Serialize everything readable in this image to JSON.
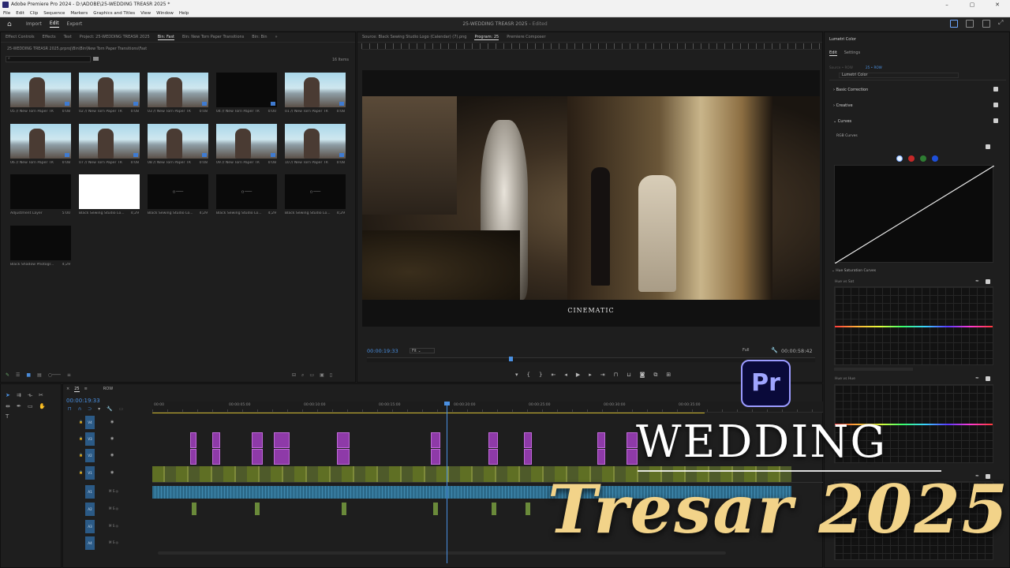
{
  "window": {
    "title": "Adobe Premiere Pro 2024 - D:\\ADOBE\\25-WEDDING TREASR 2025 *",
    "controls": [
      "–",
      "▢",
      "✕"
    ]
  },
  "menu": [
    "File",
    "Edit",
    "Clip",
    "Sequence",
    "Markers",
    "Graphics and Titles",
    "View",
    "Window",
    "Help"
  ],
  "appbar": {
    "tabs": [
      "Import",
      "Edit",
      "Export"
    ],
    "active_tab": "Edit",
    "project_name": "25-WEDDING TREASR 2025",
    "status": "Edited"
  },
  "project_panel": {
    "tabs": [
      "Effect Controls",
      "Effects",
      "Text",
      "Project: 25-WEDDING TREASR 2025",
      "Bin: Fast",
      "Bin: New Torn Paper Transitions",
      "Bin: Bin",
      "»"
    ],
    "active_tab": "Bin: Fast",
    "path": "25-WEDDING TREASR 2025.prproj\\Bin\\Bin\\New Torn Paper Transitions\\Fast",
    "item_count": "16 Items",
    "items": [
      {
        "name": "05 // New Torn Paper TR",
        "dur": "0:08",
        "kind": "photo"
      },
      {
        "name": "02 // New Torn Paper TR",
        "dur": "0:08",
        "kind": "photo"
      },
      {
        "name": "03 // New Torn Paper TR",
        "dur": "0:08",
        "kind": "photo"
      },
      {
        "name": "04 // New Torn Paper TR",
        "dur": "0:00",
        "kind": "black"
      },
      {
        "name": "01 // New Torn Paper TR",
        "dur": "0:08",
        "kind": "photo"
      },
      {
        "name": "06 // New Torn Paper TR",
        "dur": "0:08",
        "kind": "photo"
      },
      {
        "name": "07 // New Torn Paper TR",
        "dur": "0:08",
        "kind": "photo"
      },
      {
        "name": "08 // New Torn Paper TR",
        "dur": "0:08",
        "kind": "photo"
      },
      {
        "name": "09 // New Torn Paper TR",
        "dur": "0:08",
        "kind": "photo"
      },
      {
        "name": "10 // New Torn Paper TR",
        "dur": "0:08",
        "kind": "photo"
      },
      {
        "name": "Adjustment Layer",
        "dur": "5:00",
        "kind": "black"
      },
      {
        "name": "Black Sewing Studio Lo...",
        "dur": "4;29",
        "kind": "white"
      },
      {
        "name": "Black Sewing Studio Lo...",
        "dur": "4;29",
        "kind": "logo"
      },
      {
        "name": "Black Sewing Studio Lo...",
        "dur": "4;29",
        "kind": "logo"
      },
      {
        "name": "Black Sewing Studio Lo...",
        "dur": "4;29",
        "kind": "logo"
      },
      {
        "name": "Black Shadow Photogr...",
        "dur": "4;29",
        "kind": "black"
      }
    ]
  },
  "program_panel": {
    "tabs": [
      "Source: Black Sewing Studio Logo (Calendar) (7).png",
      "Program: 25",
      "Premiere Composer"
    ],
    "active_tab": "Program: 25",
    "caption": "CINEMATIC",
    "timecode_in": "00:00:19:33",
    "fit": "Fit",
    "quality": "Full",
    "timecode_out": "00:00:58:42"
  },
  "lumetri": {
    "title": "Lumetri Color",
    "tabs": [
      "Edit",
      "Settings"
    ],
    "source_label": "Source • ROW",
    "seq_label": "25 • ROW",
    "preset": "Lumetri Color",
    "sections": [
      "Basic Correction",
      "Creative",
      "Curves"
    ],
    "rgb_curves": "RGB Curves",
    "hue_sat_curves": "Hue Saturation Curves",
    "hue_vs_sat": "Hue vs Sat",
    "hue_vs_hue": "Hue vs Hue",
    "channel_colors": [
      "#e8f4ff",
      "#c62828",
      "#2e7d32",
      "#1e4fd8"
    ]
  },
  "timeline": {
    "seq_tab": "25",
    "seq_name": "ROW",
    "timecode": "00:00:19:33",
    "ruler_labels": [
      "00:00",
      "00:00:05:00",
      "00:00:10:00",
      "00:00:15:00",
      "00:00:20:00",
      "00:00:25:00",
      "00:00:30:00",
      "00:00:35:00"
    ],
    "video_tracks": [
      "V4",
      "V3",
      "V2",
      "V1"
    ],
    "audio_tracks": [
      "A1",
      "A2",
      "A3",
      "A4"
    ]
  },
  "overlay": {
    "badge": "Pr",
    "headline": "WEDDING",
    "title": "Tresar 2025"
  }
}
